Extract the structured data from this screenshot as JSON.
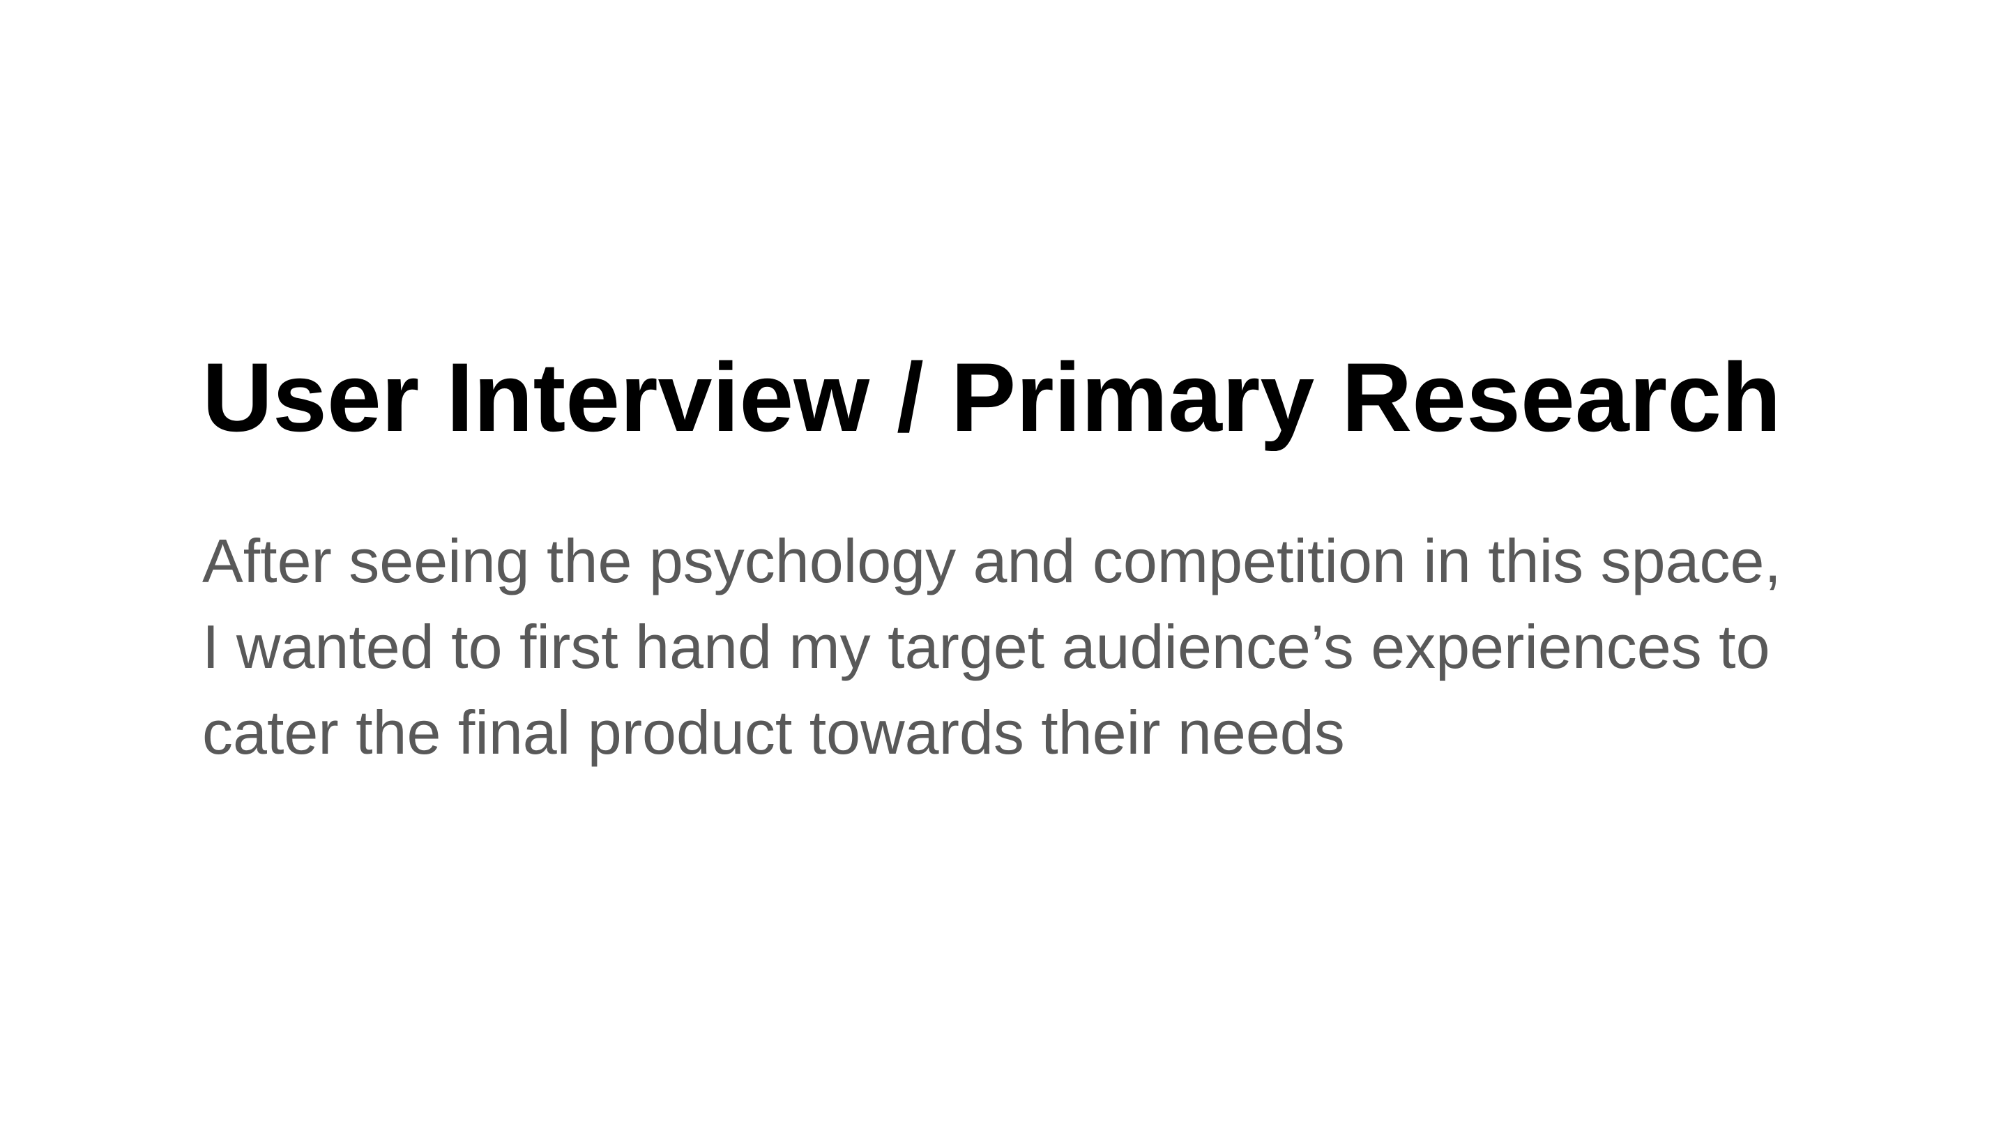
{
  "slide": {
    "title": "User Interview / Primary Research",
    "body_lines": [
      "After seeing the psychology and competition in this space,",
      "I wanted to first hand my target audience’s experiences to",
      "cater the final product towards their needs"
    ]
  },
  "colors": {
    "background": "#ffffff",
    "title": "#000000",
    "body": "#595959"
  }
}
